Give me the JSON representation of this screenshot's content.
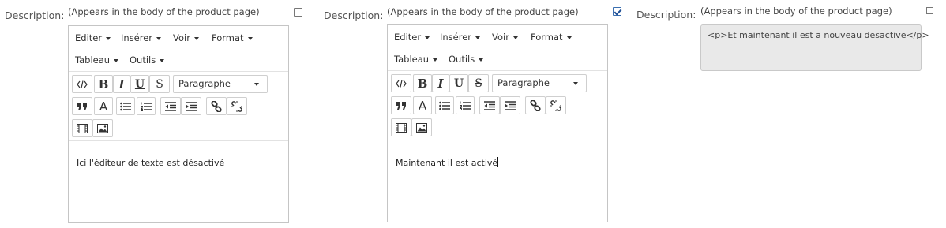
{
  "fields": [
    {
      "label": "Description:",
      "hint": "(Appears in the body of the product page)",
      "checked": false,
      "editor": {
        "menus": [
          "Editer",
          "Insérer",
          "Voir",
          "Format",
          "Tableau",
          "Outils"
        ],
        "format_select": "Paragraphe",
        "content": "Ici l'éditeur de texte est désactivé"
      }
    },
    {
      "label": "Description:",
      "hint": "(Appears in the body of the product page)",
      "checked": true,
      "editor": {
        "menus": [
          "Editer",
          "Insérer",
          "Voir",
          "Format",
          "Tableau",
          "Outils"
        ],
        "format_select": "Paragraphe",
        "content": "Maintenant il est activé"
      }
    },
    {
      "label": "Description:",
      "hint": "(Appears in the body of the product page)",
      "checked": false,
      "textarea_value": "<p>Et maintenant il est a nouveau desactive</p>"
    }
  ],
  "toolbar_icons": [
    "source-code-icon",
    "bold-icon",
    "italic-icon",
    "underline-icon",
    "strikethrough-icon",
    "blockquote-icon",
    "text-color-icon",
    "bullet-list-icon",
    "numbered-list-icon",
    "outdent-icon",
    "indent-icon",
    "link-icon",
    "unlink-icon",
    "media-icon",
    "image-icon"
  ],
  "toolbar_glyphs": {
    "bold": "B",
    "italic": "I",
    "underline": "U",
    "strike": "S",
    "color": "A"
  },
  "colors": {
    "border": "#c5c5c5",
    "disabled_bg": "#e9e9e9",
    "check_blue": "#1f4f96"
  }
}
